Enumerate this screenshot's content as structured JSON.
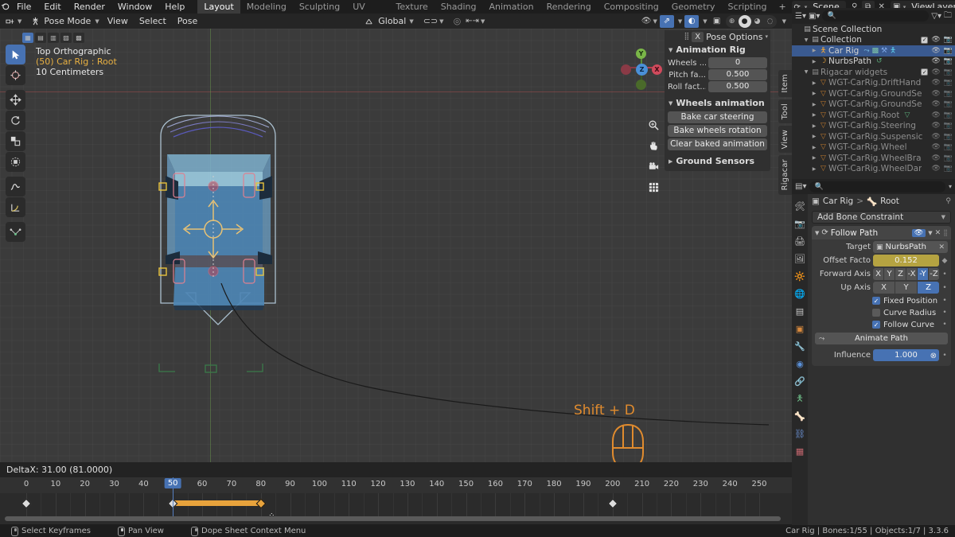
{
  "topbar": {
    "logo_icon": "blender-logo",
    "menus": [
      "File",
      "Edit",
      "Render",
      "Window",
      "Help"
    ],
    "workspaces": [
      {
        "label": "Layout",
        "active": true
      },
      {
        "label": "Modeling",
        "active": false
      },
      {
        "label": "Sculpting",
        "active": false
      },
      {
        "label": "UV Editing",
        "active": false
      },
      {
        "label": "Texture Paint",
        "active": false
      },
      {
        "label": "Shading",
        "active": false
      },
      {
        "label": "Animation",
        "active": false
      },
      {
        "label": "Rendering",
        "active": false
      },
      {
        "label": "Compositing",
        "active": false
      },
      {
        "label": "Geometry Nodes",
        "active": false
      },
      {
        "label": "Scripting",
        "active": false
      }
    ],
    "add_workspace": "+",
    "scene_name": "Scene",
    "viewlayer_name": "ViewLayer"
  },
  "viewport_header": {
    "editor_type_icon": "editor-type-icon",
    "mode": "Pose Mode",
    "menus": [
      "View",
      "Select",
      "Pose"
    ],
    "transform_orientation": "Global",
    "snap_icon": "magnet-icon",
    "proportional_icon": "proportional-edit-icon",
    "shading_modes": [
      "wireframe",
      "solid",
      "material",
      "rendered"
    ],
    "selected_shading": "solid"
  },
  "viewport": {
    "overlay": {
      "view_name": "Top Orthographic",
      "active_object": "(50) Car Rig : Root",
      "grid_scale": "10 Centimeters"
    },
    "gizmo_axes": {
      "x": "X",
      "y": "Y",
      "z": "Z"
    },
    "tools": [
      {
        "name": "tweak-tool",
        "glyph": "➤",
        "active": true
      },
      {
        "name": "cursor-tool",
        "glyph": "⨁",
        "active": false
      },
      {
        "name": "move-tool",
        "glyph": "✥",
        "active": false
      },
      {
        "name": "rotate-tool",
        "glyph": "↻",
        "active": false
      },
      {
        "name": "scale-tool",
        "glyph": "◱",
        "active": false
      },
      {
        "name": "transform-tool",
        "glyph": "◎",
        "active": false
      },
      {
        "name": "annotate-tool",
        "glyph": "✎",
        "active": false
      },
      {
        "name": "measure-tool",
        "glyph": "∠",
        "active": false
      },
      {
        "name": "breakdowner-tool",
        "glyph": "∨",
        "active": false
      }
    ],
    "nav_buttons": [
      {
        "name": "zoom-icon",
        "glyph": "🔍"
      },
      {
        "name": "pan-hand-icon",
        "glyph": "✋"
      },
      {
        "name": "camera-view-icon",
        "glyph": "🎥"
      },
      {
        "name": "toggle-ortho-icon",
        "glyph": "▦"
      }
    ],
    "hint": {
      "text": "Shift + D",
      "icon": "mouse-icon",
      "color": "#e08b2e"
    }
  },
  "npanel": {
    "header_label": "Pose Options",
    "header_pill": "X",
    "sections": [
      {
        "title": "Animation Rig",
        "open": true,
        "rows": [
          {
            "label": "Wheels ...",
            "value": "0"
          },
          {
            "label": "Pitch fa...",
            "value": "0.500"
          },
          {
            "label": "Roll fact...",
            "value": "0.500"
          }
        ]
      },
      {
        "title": "Wheels animation",
        "open": true,
        "buttons": [
          "Bake car steering",
          "Bake wheels rotation",
          "Clear baked animation"
        ]
      },
      {
        "title": "Ground Sensors",
        "open": false,
        "rows": []
      }
    ],
    "tabs": [
      "Item",
      "Tool",
      "View",
      "Rigacar"
    ]
  },
  "dopesheet": {
    "status_text": "DeltaX: 31.00 (81.0000)",
    "ticks": [
      0,
      10,
      20,
      30,
      40,
      50,
      60,
      70,
      80,
      90,
      100,
      110,
      120,
      130,
      140,
      150,
      160,
      170,
      180,
      190,
      200,
      210,
      220,
      230,
      240,
      250
    ],
    "current_frame": 50,
    "current_frame_label": "50",
    "keyframes": [
      {
        "frame": 0,
        "selected": false
      },
      {
        "frame": 50,
        "selected": false
      },
      {
        "frame": 80,
        "selected": true
      },
      {
        "frame": 200,
        "selected": false
      }
    ],
    "selection_bar": {
      "start": 50,
      "end": 80
    }
  },
  "outliner": {
    "filter_icon": "filter-icon",
    "display_mode_icon": "view-layer-icon",
    "search_placeholder": "",
    "search_icon": "search-icon",
    "new_collection_icon": "new-collection-icon",
    "rows": [
      {
        "label": "Scene Collection",
        "indent": 0,
        "icon": "scene-collection-icon",
        "icon_color": "#b0b0b0",
        "tri": "",
        "selected": false,
        "dim": false,
        "checkbox": false,
        "eye": false,
        "camera": false
      },
      {
        "label": "Collection",
        "indent": 1,
        "icon": "collection-icon",
        "icon_color": "#b0b0b0",
        "tri": "▼",
        "selected": false,
        "dim": false,
        "checkbox": true,
        "eye": true,
        "camera": true
      },
      {
        "label": "Car Rig",
        "indent": 2,
        "icon": "armature-icon",
        "icon_color": "#e8a33c",
        "tri": "▶",
        "selected": true,
        "dim": false,
        "checkbox": false,
        "eye": true,
        "camera": true,
        "badges": [
          "constraint-icon",
          "modifier-icon",
          "pose-icon",
          "armature-data-icon"
        ]
      },
      {
        "label": "NurbsPath",
        "indent": 2,
        "icon": "curve-icon",
        "icon_color": "#e8a33c",
        "tri": "▶",
        "selected": false,
        "dim": false,
        "checkbox": false,
        "eye": true,
        "camera": true,
        "badges": [
          "curve-data-icon"
        ]
      },
      {
        "label": "Rigacar widgets",
        "indent": 1,
        "icon": "collection-icon",
        "icon_color": "#8e8e8e",
        "tri": "▼",
        "selected": false,
        "dim": true,
        "checkbox": true,
        "eye": true,
        "camera": true
      },
      {
        "label": "WGT-CarRig.DriftHand",
        "indent": 2,
        "icon": "mesh-icon",
        "icon_color": "#c07a2e",
        "tri": "▶",
        "selected": false,
        "dim": true,
        "checkbox": false,
        "eye": true,
        "camera": true
      },
      {
        "label": "WGT-CarRig.GroundSe",
        "indent": 2,
        "icon": "mesh-icon",
        "icon_color": "#c07a2e",
        "tri": "▶",
        "selected": false,
        "dim": true,
        "checkbox": false,
        "eye": true,
        "camera": true
      },
      {
        "label": "WGT-CarRig.GroundSe",
        "indent": 2,
        "icon": "mesh-icon",
        "icon_color": "#c07a2e",
        "tri": "▶",
        "selected": false,
        "dim": true,
        "checkbox": false,
        "eye": true,
        "camera": true
      },
      {
        "label": "WGT-CarRig.Root",
        "indent": 2,
        "icon": "mesh-icon",
        "icon_color": "#c07a2e",
        "tri": "▶",
        "selected": false,
        "dim": true,
        "checkbox": false,
        "eye": true,
        "camera": true,
        "badges": [
          "mesh-data-icon"
        ]
      },
      {
        "label": "WGT-CarRig.Steering",
        "indent": 2,
        "icon": "mesh-icon",
        "icon_color": "#c07a2e",
        "tri": "▶",
        "selected": false,
        "dim": true,
        "checkbox": false,
        "eye": true,
        "camera": true
      },
      {
        "label": "WGT-CarRig.Suspensic",
        "indent": 2,
        "icon": "mesh-icon",
        "icon_color": "#c07a2e",
        "tri": "▶",
        "selected": false,
        "dim": true,
        "checkbox": false,
        "eye": true,
        "camera": true
      },
      {
        "label": "WGT-CarRig.Wheel",
        "indent": 2,
        "icon": "mesh-icon",
        "icon_color": "#c07a2e",
        "tri": "▶",
        "selected": false,
        "dim": true,
        "checkbox": false,
        "eye": true,
        "camera": true
      },
      {
        "label": "WGT-CarRig.WheelBra",
        "indent": 2,
        "icon": "mesh-icon",
        "icon_color": "#c07a2e",
        "tri": "▶",
        "selected": false,
        "dim": true,
        "checkbox": false,
        "eye": true,
        "camera": true
      },
      {
        "label": "WGT-CarRig.WheelDar",
        "indent": 2,
        "icon": "mesh-icon",
        "icon_color": "#c07a2e",
        "tri": "▶",
        "selected": false,
        "dim": true,
        "checkbox": false,
        "eye": true,
        "camera": true
      }
    ]
  },
  "properties": {
    "editor_icon": "properties-editor-icon",
    "search_placeholder": "",
    "breadcrumb": {
      "object": "Car Rig",
      "separator": ">",
      "bone": "Root"
    },
    "add_constraint_label": "Add Bone Constraint",
    "constraint": {
      "name": "Follow Path",
      "icon": "follow-path-icon",
      "enabled": true,
      "target_label": "Target",
      "target_value": "NurbsPath",
      "offset_label": "Offset Facto",
      "offset_value": "0.152",
      "forward_axis_label": "Forward Axis",
      "forward_axis_options": [
        "X",
        "Y",
        "Z",
        "-X",
        "-Y",
        "-Z"
      ],
      "forward_axis_selected": "-Y",
      "up_axis_label": "Up Axis",
      "up_axis_options": [
        "X",
        "Y",
        "Z"
      ],
      "up_axis_selected": "Z",
      "checkboxes": [
        {
          "label": "Fixed Position",
          "checked": true
        },
        {
          "label": "Curve Radius",
          "checked": false
        },
        {
          "label": "Follow Curve",
          "checked": true
        }
      ],
      "animate_path_label": "Animate Path",
      "influence_label": "Influence",
      "influence_value": "1.000"
    },
    "tab_icons": [
      "tool-icon",
      "render-icon",
      "output-icon",
      "view-layer-icon",
      "scene-icon",
      "world-icon",
      "collection-icon",
      "object-icon",
      "modifier-icon",
      "physics-icon",
      "object-constraint-icon",
      "armature-data-icon",
      "bone-icon",
      "bone-constraint-icon",
      "texture-icon"
    ]
  },
  "statusbar": {
    "items": [
      {
        "icon": "mouse-left-icon",
        "label": "Select Keyframes"
      },
      {
        "icon": "mouse-middle-icon",
        "label": "Pan View"
      },
      {
        "icon": "mouse-right-icon",
        "label": "Dope Sheet Context Menu"
      }
    ],
    "right_text": "Car Rig | Bones:1/55 | Objects:1/7 | 3.3.6"
  },
  "colors": {
    "accent_blue": "#4772b3",
    "accent_orange": "#e8a33c",
    "select_row": "#3a5a90",
    "viewport_bg": "#3b3b3b"
  }
}
